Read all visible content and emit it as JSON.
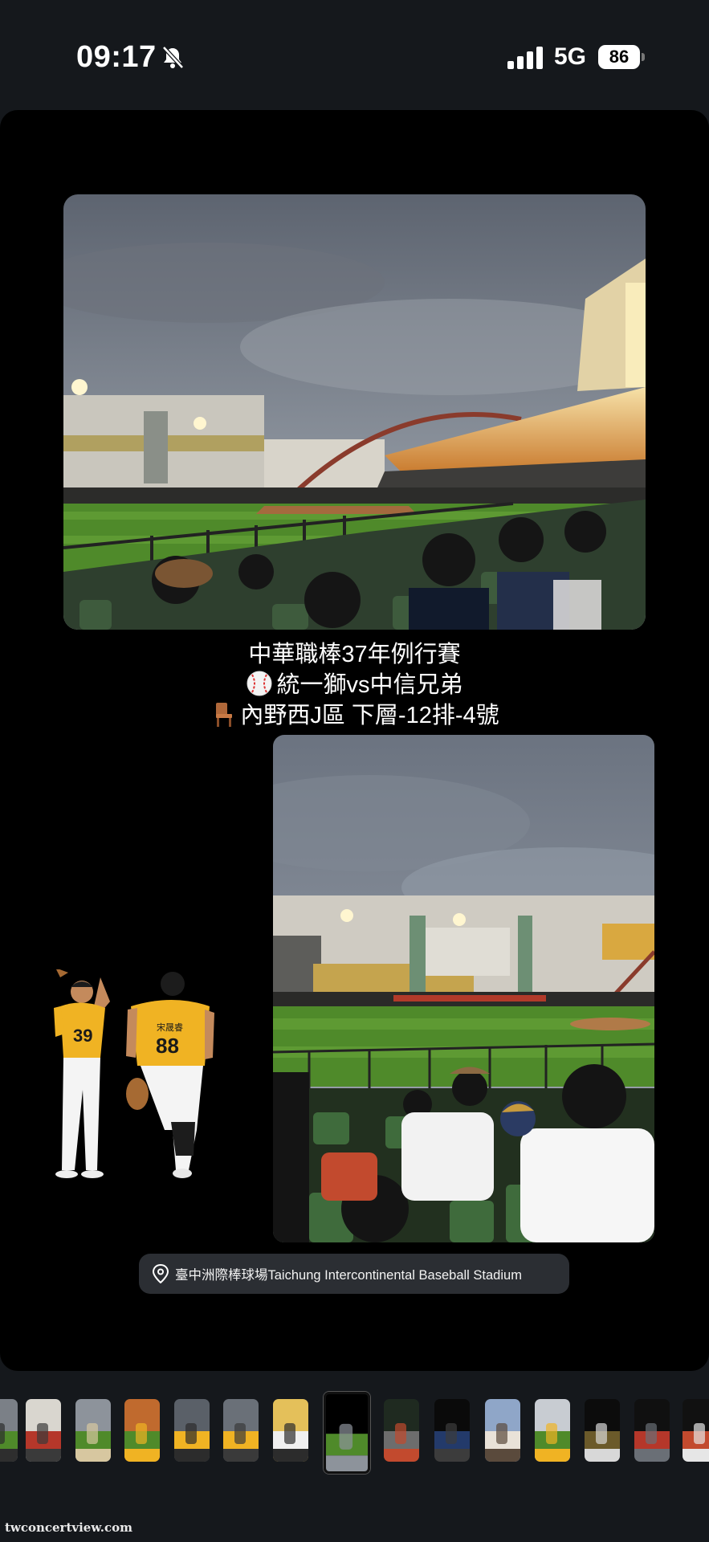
{
  "status_bar": {
    "time": "09:17",
    "network": "5G",
    "battery": "86",
    "icons": [
      "bell-slash-icon",
      "signal-icon",
      "battery-icon"
    ]
  },
  "story": {
    "caption": {
      "line1": "中華職棒37年例行賽",
      "line2": "統一獅vs中信兄弟",
      "line3": "內野西J區 下層-12排-4號",
      "line2_icon": "baseball-emoji",
      "line3_icon": "chair-emoji"
    },
    "location": {
      "icon": "location-pin-icon",
      "label": "臺中洲際棒球場Taichung Intercontinental Baseball Stadium"
    },
    "player_jerseys": [
      "39",
      "88"
    ],
    "player_name": "宋晟睿"
  },
  "thumbnail_strip": {
    "count": 15,
    "active_index": 7
  },
  "watermark": "twconcertview.com",
  "colors": {
    "background": "#15181c",
    "story_bg": "#000000",
    "location_pill": "#2b2e33",
    "jersey_yellow": "#f0b323",
    "field_green": "#4f8a2a"
  }
}
